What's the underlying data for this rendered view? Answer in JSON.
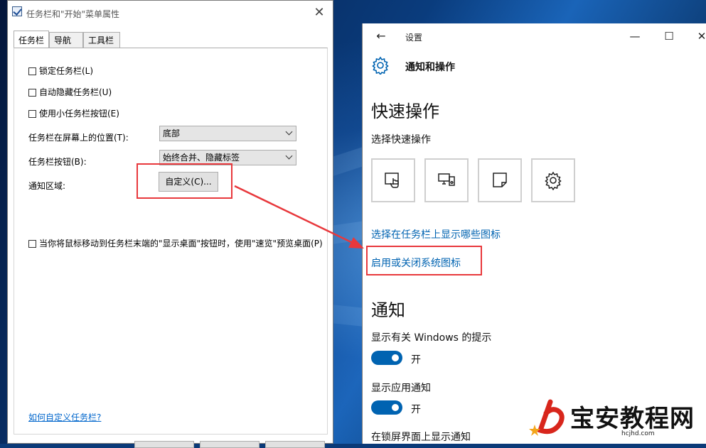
{
  "dialog": {
    "title": "任务栏和\"开始\"菜单属性",
    "tabs": [
      {
        "label": "任务栏",
        "active": true
      },
      {
        "label": "导航",
        "active": false
      },
      {
        "label": "工具栏",
        "active": false
      }
    ],
    "checkboxes": [
      {
        "label": "锁定任务栏(L)",
        "checked": false
      },
      {
        "label": "自动隐藏任务栏(U)",
        "checked": false
      },
      {
        "label": "使用小任务栏按钮(E)",
        "checked": false
      }
    ],
    "position_label": "任务栏在屏幕上的位置(T):",
    "position_value": "底部",
    "buttons_label": "任务栏按钮(B):",
    "buttons_value": "始终合并、隐藏标签",
    "notify_label": "通知区域:",
    "customize_button": "自定义(C)...",
    "peek_checkbox": "当你将鼠标移动到任务栏末端的\"显示桌面\"按钮时，使用\"速览\"预览桌面(P)",
    "help_link": "如何自定义任务栏?"
  },
  "settings": {
    "window_title": "设置",
    "header_title": "通知和操作",
    "quick_actions_title": "快速操作",
    "quick_actions_subtitle": "选择快速操作",
    "quick_action_icons": [
      "tablet-mode-icon",
      "project-icon",
      "note-icon",
      "settings-gear-icon"
    ],
    "link_taskbar_icons": "选择在任务栏上显示哪些图标",
    "link_system_icons": "启用或关闭系统图标",
    "notifications_title": "通知",
    "windows_tips_label": "显示有关 Windows 的提示",
    "windows_tips_state": "开",
    "app_notifications_label": "显示应用通知",
    "app_notifications_state": "开",
    "lock_screen_label": "在锁屏界面上显示通知"
  },
  "watermark": {
    "text": "宝安教程网",
    "sub": "hcjhd.com"
  },
  "colors": {
    "accent": "#0063b1",
    "annotation": "#e8383c",
    "link": "#0066cc"
  }
}
